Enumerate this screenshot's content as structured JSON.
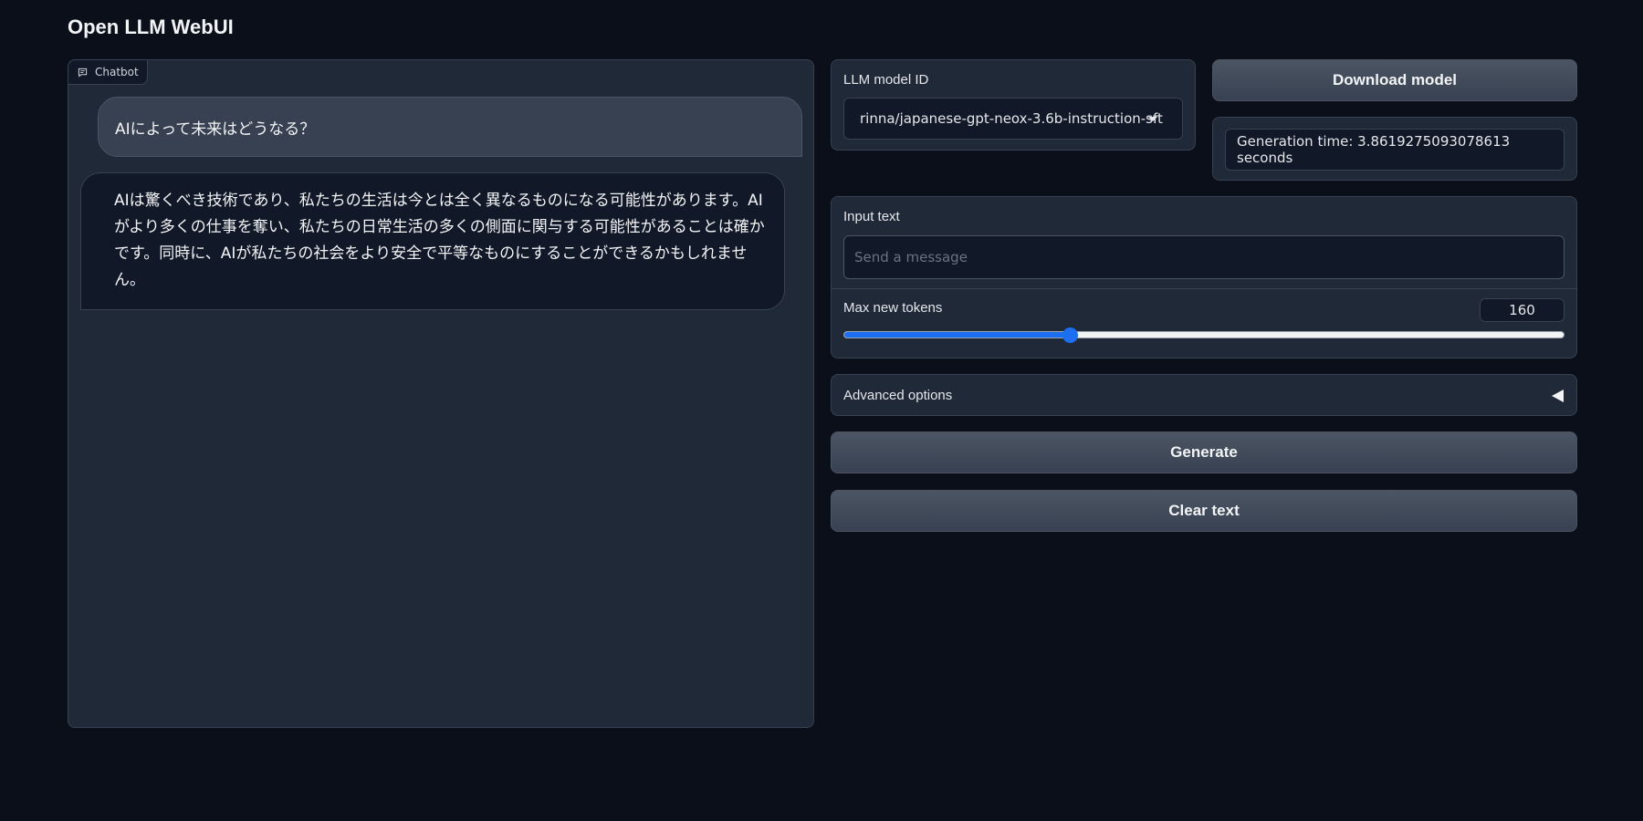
{
  "page": {
    "title": "Open LLM WebUI"
  },
  "chatbot": {
    "label": "Chatbot",
    "messages": [
      {
        "role": "user",
        "text": "AIによって未来はどうなる？"
      },
      {
        "role": "bot",
        "text": "AIは驚くべき技術であり、私たちの生活は今とは全く異なるものになる可能性があります。AIがより多くの仕事を奪い、私たちの日常生活の多くの側面に関与する可能性があることは確かです。同時に、AIが私たちの社会をより安全で平等なものにすることができるかもしれません。"
      }
    ]
  },
  "model": {
    "label": "LLM model ID",
    "selected": "rinna/japanese-gpt-neox-3.6b-instruction-sft",
    "download_label": "Download model"
  },
  "generation_time": {
    "text": "Generation time: 3.8619275093078613 seconds"
  },
  "input": {
    "label": "Input text",
    "value": "",
    "placeholder": "Send a message"
  },
  "max_new_tokens": {
    "label": "Max new tokens",
    "value": "160",
    "fraction": 0.314
  },
  "advanced": {
    "label": "Advanced options"
  },
  "buttons": {
    "generate": "Generate",
    "clear": "Clear text"
  },
  "icons": {
    "chatbot": "chat-bubble-icon",
    "dropdown": "chevron-down-icon",
    "accordion": "triangle-left-icon"
  },
  "colors": {
    "background": "#0b0f19",
    "panel": "#1f2937",
    "accent": "#1d6ff2"
  }
}
